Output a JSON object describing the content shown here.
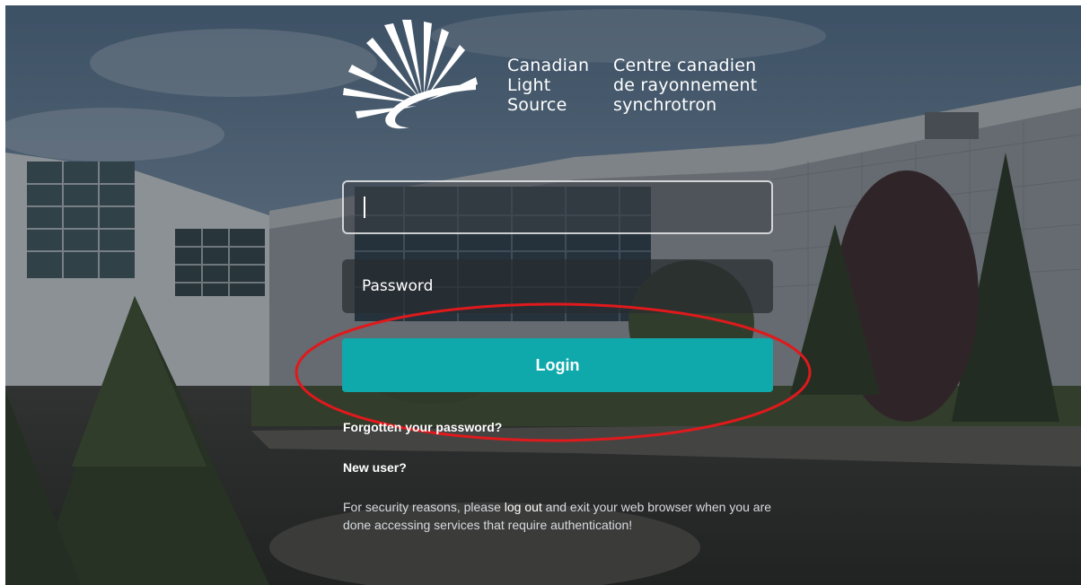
{
  "logo": {
    "english_lines": [
      "Canadian",
      "Light",
      "Source"
    ],
    "french_lines": [
      "Centre canadien",
      "de rayonnement",
      "synchrotron"
    ],
    "icon": "sunburst-logo-icon"
  },
  "form": {
    "username_value": "",
    "password_placeholder": "Password",
    "login_label": "Login"
  },
  "links": {
    "forgot_password": "Forgotten your password?",
    "new_user": "New user?"
  },
  "notice": {
    "before": "For security reasons, please ",
    "logout_link": "log out",
    "after": " and exit your web browser when you are done accessing services that require authentication!"
  },
  "colors": {
    "accent": "#0fa9ac",
    "annotation": "#e0191c"
  }
}
